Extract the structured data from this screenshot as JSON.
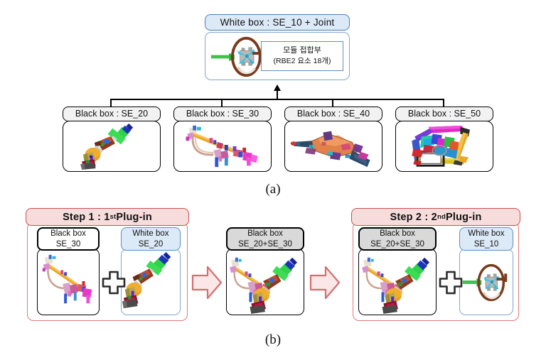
{
  "figure": {
    "panel_a_caption": "(a)",
    "panel_b_caption": "(b)"
  },
  "panel_a": {
    "white_box": {
      "header": "White box : SE_10 + Joint",
      "note_line1": "모듈 접합부",
      "note_line2": "(RBE2 요소 18개)",
      "model": "steering-column-joint"
    },
    "black_boxes": [
      {
        "header": "Black box : SE_20",
        "model": "se20-steering-column"
      },
      {
        "header": "Black box : SE_30",
        "model": "se30-cross-car-beam"
      },
      {
        "header": "Black box : SE_40",
        "model": "se40-crash-pad"
      },
      {
        "header": "Black box : SE_50",
        "model": "se50-cockpit-module"
      }
    ]
  },
  "panel_b": {
    "steps": [
      {
        "title_prefix": "Step 1 : 1",
        "title_sup": "st",
        "title_suffix": " Plug-in",
        "inputs": [
          {
            "type": "black",
            "line1": "Black box",
            "line2": "SE_30",
            "model": "se30-cross-car-beam"
          },
          {
            "type": "white",
            "line1": "White box",
            "line2": "SE_20",
            "model": "se20-steering-column"
          }
        ],
        "operator": "plus-sign"
      },
      {
        "title_prefix": "Step 2 : 2",
        "title_sup": "nd",
        "title_suffix": " Plug-in",
        "inputs": [
          {
            "type": "black-gray",
            "line1": "Black box",
            "line2": "SE_20+SE_30",
            "model": "se2030-combined"
          },
          {
            "type": "white",
            "line1": "White box",
            "line2": "SE_10",
            "model": "steering-column-joint"
          }
        ],
        "operator": "plus-sign"
      }
    ],
    "intermediate": {
      "line1": "Black box",
      "line2": "SE_20+SE_30",
      "model": "se2030-combined"
    },
    "arrows": [
      "block-arrow-right",
      "block-arrow-right"
    ]
  },
  "colors": {
    "white_box_fill": "#dce9f7",
    "white_box_border": "#4a7fb5",
    "black_box_border": "#000000",
    "gray_fill": "#d9d9d9",
    "step_header_fill": "#f7dcdc",
    "step_header_border": "#c9504f",
    "arrow_fill": "#fbe7e7",
    "arrow_border": "#d46f6f"
  }
}
